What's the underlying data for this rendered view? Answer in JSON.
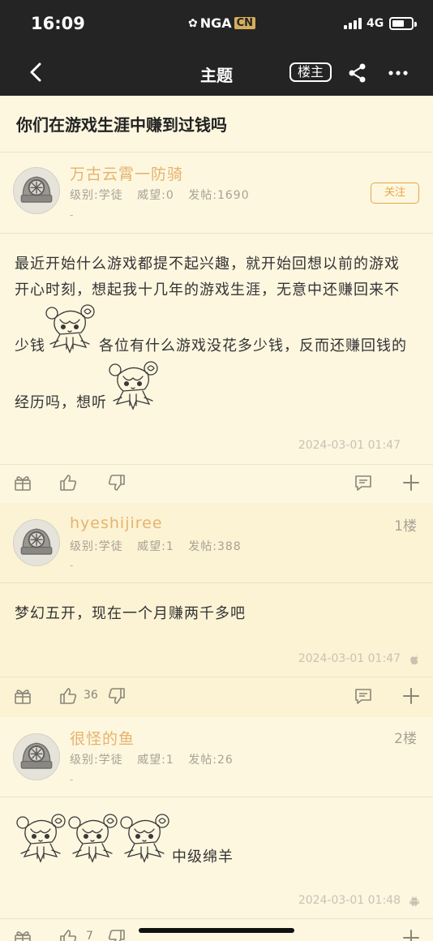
{
  "status_bar": {
    "time": "16:09",
    "brand_main": "NGA",
    "brand_tag": "CN",
    "network": "4G"
  },
  "nav": {
    "title": "主题",
    "op_badge": "楼主"
  },
  "topic": {
    "title": "你们在游戏生涯中赚到过钱吗"
  },
  "posts": [
    {
      "username": "万古云霄一防骑",
      "level": "级别:学徒",
      "reputation": "威望:0",
      "post_count": "发帖:1690",
      "signature": "-",
      "follow_label": "关注",
      "body_lines": [
        "最近开始什么游戏都提不起兴趣，就开始回想以前的游戏",
        "开心时刻，想起我十几年的游戏生涯，无意中还赚回来不",
        "少钱",
        "各位有什么游戏没花多少钱，反而还赚回钱的",
        "经历吗，想听"
      ],
      "timestamp": "2024-03-01 01:47"
    },
    {
      "username": "hyeshijiree",
      "floor": "1楼",
      "level": "级别:学徒",
      "reputation": "威望:1",
      "post_count": "发帖:388",
      "signature": "-",
      "body": "梦幻五开，现在一个月赚两千多吧",
      "timestamp": "2024-03-01 01:47",
      "platform_icon": "apple-icon",
      "like_count": "36"
    },
    {
      "username": "很怪的鱼",
      "floor": "2楼",
      "level": "级别:学徒",
      "reputation": "威望:1",
      "post_count": "发帖:26",
      "signature": "-",
      "body": "中级绵羊",
      "timestamp": "2024-03-01 01:48",
      "platform_icon": "android-icon",
      "like_count": "7"
    }
  ],
  "colors": {
    "bar": "#242424",
    "background": "#fdf7e0",
    "username": "#e6b36d",
    "accent": "#e6a545"
  }
}
